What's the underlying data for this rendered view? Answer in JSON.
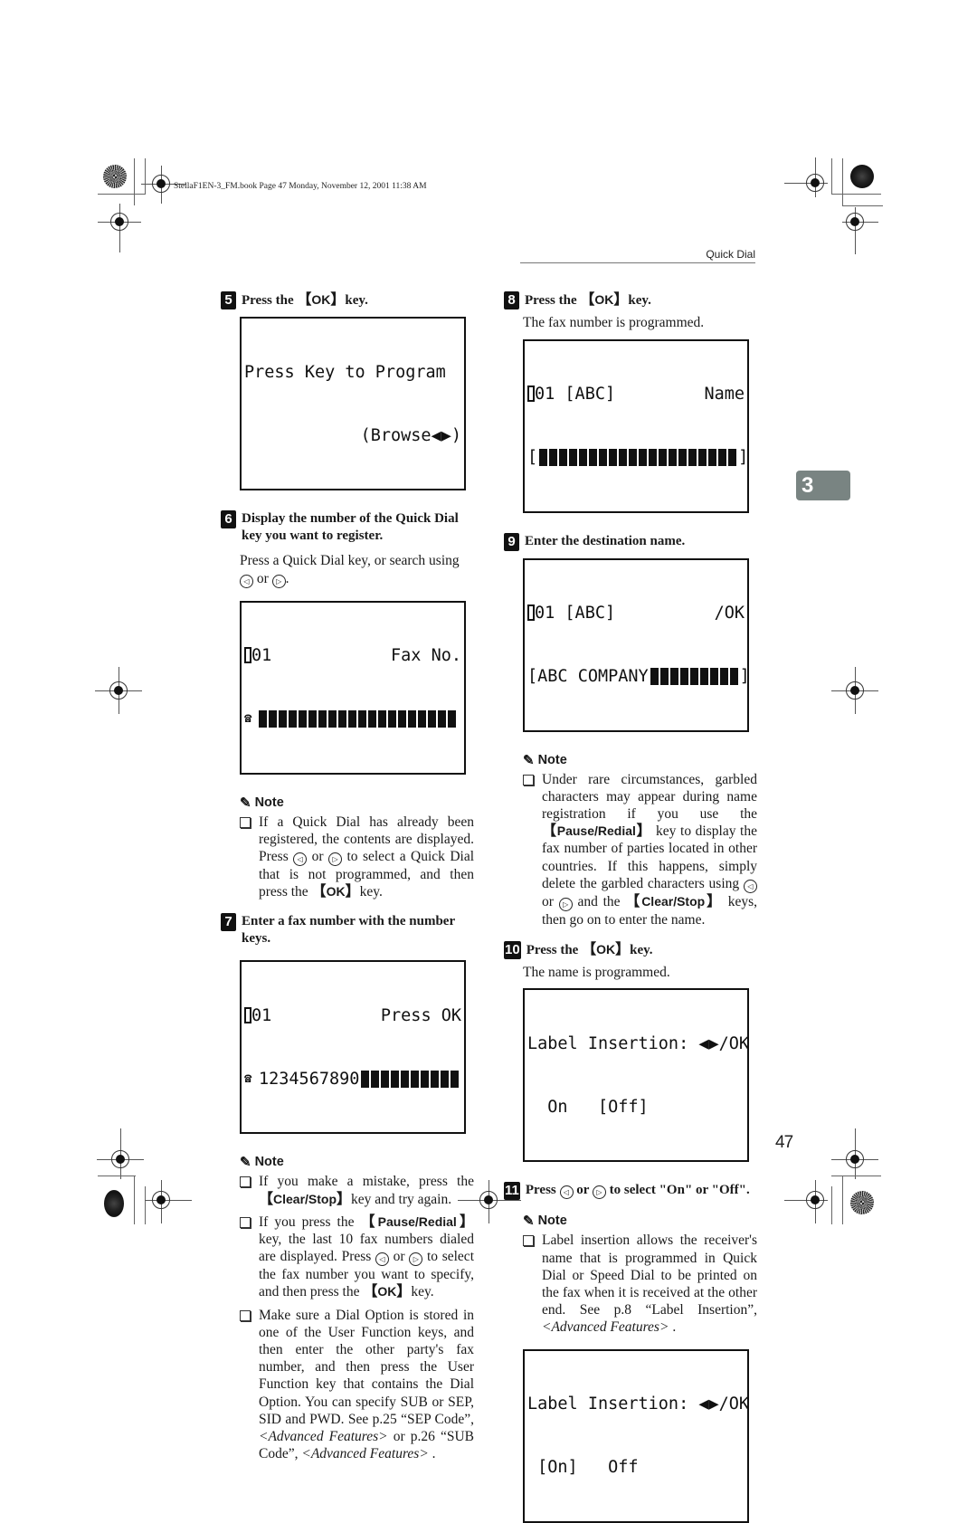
{
  "header": {
    "book_meta": "StellaF1EN-3_FM.book  Page 47  Monday, November 12, 2001  11:38 AM",
    "section_title": "Quick Dial"
  },
  "chapter_tab": "3",
  "page_number": "47",
  "keys": {
    "ok": "OK",
    "clear_stop": "Clear/Stop",
    "pause_redial": "Pause/Redial"
  },
  "icons": {
    "pencil": "✎",
    "left_arrow": "◁",
    "right_arrow": "▷",
    "phone": "☎"
  },
  "steps": {
    "s5": {
      "num": "5",
      "pre": "Press the",
      "post": "key."
    },
    "s6": {
      "num": "6",
      "text": "Display the number of the Quick Dial key you want to register.",
      "body_pre": "Press a Quick Dial key, or search using",
      "body_mid": "or",
      "body_post": "."
    },
    "s7": {
      "num": "7",
      "text": "Enter a fax number with the number keys."
    },
    "s8": {
      "num": "8",
      "pre": "Press the",
      "post": "key.",
      "body": "The fax number is programmed."
    },
    "s9": {
      "num": "9",
      "text": "Enter the destination name."
    },
    "s10": {
      "num": "10",
      "pre": "Press the",
      "post": "key.",
      "body": "The name is programmed."
    },
    "s11": {
      "num": "11",
      "pre": "Press",
      "mid": "or",
      "post": "to select \"On\" or \"Off\"."
    }
  },
  "lcd": {
    "program": {
      "line1": "Press Key to Program",
      "line2": "(Browse◀▶)"
    },
    "fax_no": {
      "line1_left": "01",
      "line1_right": "Fax No."
    },
    "press_ok": {
      "line1_left": "01",
      "line1_right": "Press OK",
      "number": "1234567890"
    },
    "name": {
      "line1_left": "01 [ABC]",
      "line1_right": "Name",
      "open": "[",
      "close": "]"
    },
    "name_entered": {
      "line1_left": "01 [ABC]",
      "line1_right": "/OK",
      "value": "[ABC COMPANY",
      "close": "]"
    },
    "label_off": {
      "line1": "Label Insertion: ◀▶/OK",
      "line2": "  On   [Off]"
    },
    "label_on": {
      "line1": "Label Insertion: ◀▶/OK",
      "line2": " [On]   Off"
    }
  },
  "notes": {
    "label": "Note",
    "n6": {
      "pre": "If a Quick Dial has already been registered, the contents are displayed. Press",
      "mid": "or",
      "post": "to select a Quick Dial that is not programmed, and then press the",
      "end": "key."
    },
    "n7a": {
      "pre": "If you make a mistake, press the",
      "post": "key and try again."
    },
    "n7b": {
      "pre": "If you press the",
      "mid1": "key, the last 10 fax numbers dialed are displayed. Press",
      "mid2": "or",
      "mid3": "to select the fax number you want to specify, and then press the",
      "end": "key."
    },
    "n7c": {
      "text": "Make sure a Dial Option is stored in one of the User Function keys, and then enter the other party's fax number, and then press the User Function key that contains the Dial Option. You can specify SUB or SEP, SID and PWD. See p.25 “SEP Code”,",
      "ref1": "<Advanced Features>",
      "mid": " or p.26 “SUB Code”,",
      "ref2": "<Advanced Features>",
      "end": " ."
    },
    "n9": {
      "pre": "Under rare circumstances, garbled characters may appear during name registration if you use the",
      "mid1": "key to display the fax number of parties located in other countries. If this happens, simply delete the garbled characters using",
      "mid2": "or",
      "mid3": "and the",
      "end": "keys, then go on to enter the name."
    },
    "n11": {
      "pre": "Label insertion allows the receiver's name that is programmed in Quick Dial or Speed Dial to be printed on the fax when it is received at the other end. See p.8 “Label Insertion”,",
      "ref": "<Advanced Features>",
      "end": " ."
    }
  }
}
